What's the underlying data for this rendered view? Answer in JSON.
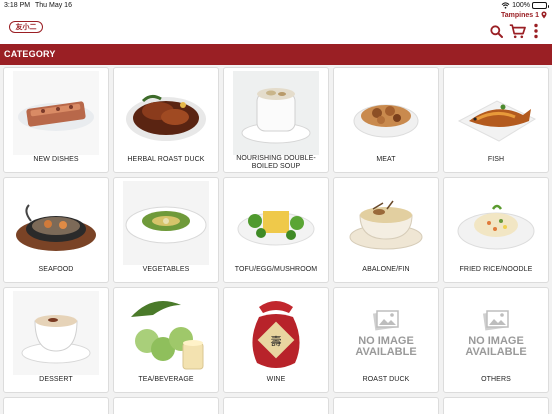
{
  "status_bar": {
    "time": "3:18 PM",
    "date": "Thu May 16",
    "battery": "100%"
  },
  "header": {
    "logo_text": "友小二",
    "location": "Tampines 1",
    "brand_color": "#9a1f24"
  },
  "category_bar": {
    "title": "CATEGORY"
  },
  "categories": [
    {
      "label": "NEW DISHES",
      "image": "dish-photo"
    },
    {
      "label": "HERBAL ROAST DUCK",
      "image": "dish-photo"
    },
    {
      "label": "NOURISHING DOUBLE-BOILED SOUP",
      "image": "dish-photo"
    },
    {
      "label": "MEAT",
      "image": "dish-photo"
    },
    {
      "label": "FISH",
      "image": "dish-photo"
    },
    {
      "label": "SEAFOOD",
      "image": "dish-photo"
    },
    {
      "label": "VEGETABLES",
      "image": "dish-photo"
    },
    {
      "label": "TOFU/EGG/MUSHROOM",
      "image": "dish-photo"
    },
    {
      "label": "ABALONE/FIN",
      "image": "dish-photo"
    },
    {
      "label": "FRIED RICE/NOODLE",
      "image": "dish-photo"
    },
    {
      "label": "DESSERT",
      "image": "dish-photo"
    },
    {
      "label": "TEA/BEVERAGE",
      "image": "dish-photo"
    },
    {
      "label": "WINE",
      "image": "wine-jar-photo"
    },
    {
      "label": "ROAST DUCK",
      "image": "no-image"
    },
    {
      "label": "OTHERS",
      "image": "no-image"
    }
  ],
  "placeholder": {
    "no_image_line1": "NO IMAGE",
    "no_image_line2": "AVAILABLE"
  }
}
